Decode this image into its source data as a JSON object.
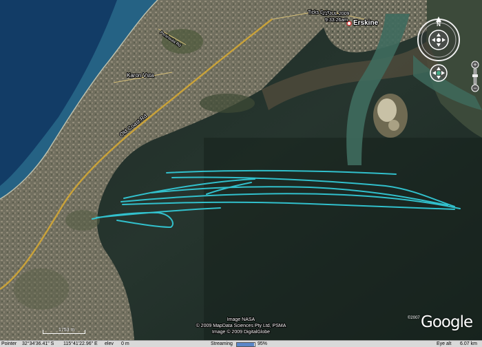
{
  "map": {
    "places": {
      "erskine": "Erskine",
      "karon_vista": "Karon Vsta",
      "old_coast_rd": "Old Coast Rd",
      "ticks_street": "Ticks Drve",
      "lakes_rd": "Peninsula Rd"
    },
    "timestamp_line1": "21 JUL 2009",
    "timestamp_line2": "9:33:26am",
    "scale_label": "1753 m",
    "credits": [
      "Image NASA",
      "© 2009 MapData Sciences Pty Ltd, PSMA",
      "Image © 2009 DigitalGlobe"
    ],
    "google_copyright": "©2007",
    "google_logo": "Google",
    "track_color": "#33c9d6"
  },
  "navigation": {
    "north_label": "N",
    "compass_icon": "compass-ring-icon",
    "look_icon": "look-joystick-icon",
    "move_icon": "move-joystick-icon",
    "zoom_in": "+",
    "zoom_out": "−"
  },
  "statusbar": {
    "pointer_label": "Pointer",
    "latitude": "32°34'36.41\" S",
    "longitude": "115°41'22.96\" E",
    "elev_label": "elev",
    "elev_value": "0 m",
    "streaming_label": "Streaming",
    "streaming_value": "95%",
    "streaming_progress": 0.95,
    "eye_alt_label": "Eye alt",
    "eye_alt_value": "6.07 km"
  }
}
